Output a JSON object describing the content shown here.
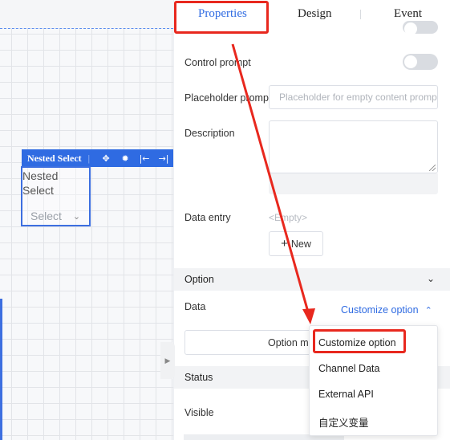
{
  "tabs": {
    "properties": "Properties",
    "design": "Design",
    "event": "Event",
    "active": "Properties"
  },
  "canvas": {
    "component": {
      "toolbar_label": "Nested Select",
      "toolbar_icons": [
        "move-icon",
        "bug-icon",
        "align-left-icon",
        "align-right-icon"
      ],
      "title": "Nested Select",
      "select_placeholder": "Select"
    }
  },
  "properties": {
    "control_prompt": {
      "label": "Control prompt",
      "enabled": false
    },
    "placeholder_prompt": {
      "label": "Placeholder prompt",
      "placeholder": "Placeholder for empty content prompt"
    },
    "description": {
      "label": "Description",
      "value": ""
    },
    "data_entry": {
      "label": "Data entry",
      "empty_text": "<Empty>",
      "new_button": "New"
    },
    "option_section": {
      "title": "Option",
      "data_label": "Data",
      "data_value": "Customize option",
      "option_button": "Option ma"
    },
    "status_section": {
      "title": "Status",
      "visible_label": "Visible"
    }
  },
  "dropdown": {
    "items": [
      "Customize option",
      "Channel Data",
      "External API",
      "自定义变量"
    ],
    "highlighted": "Customize option"
  },
  "colors": {
    "accent": "#2f6be2",
    "annotation": "#e8281e"
  }
}
